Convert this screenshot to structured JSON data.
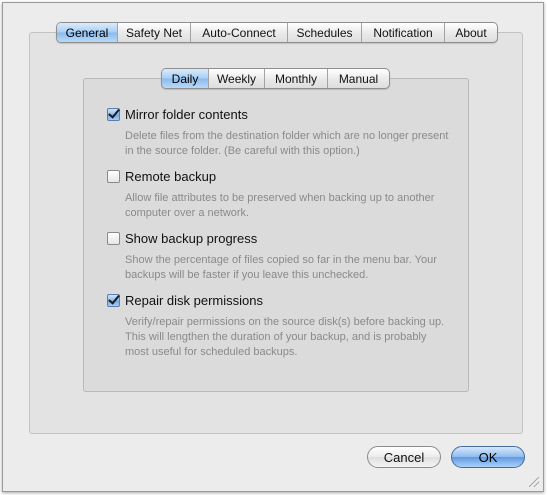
{
  "main_tabs": [
    {
      "label": "General",
      "selected": true
    },
    {
      "label": "Safety Net",
      "selected": false
    },
    {
      "label": "Auto-Connect",
      "selected": false
    },
    {
      "label": "Schedules",
      "selected": false
    },
    {
      "label": "Notification",
      "selected": false
    },
    {
      "label": "About",
      "selected": false
    }
  ],
  "sub_tabs": [
    {
      "label": "Daily",
      "selected": true
    },
    {
      "label": "Weekly",
      "selected": false
    },
    {
      "label": "Monthly",
      "selected": false
    },
    {
      "label": "Manual",
      "selected": false
    }
  ],
  "options": [
    {
      "label": "Mirror folder contents",
      "checked": true,
      "description": "Delete files from the destination folder which are no longer present in the source folder. (Be careful with this option.)"
    },
    {
      "label": "Remote backup",
      "checked": false,
      "description": "Allow file attributes to be preserved when backing up to another computer over a network."
    },
    {
      "label": "Show backup progress",
      "checked": false,
      "description": "Show the percentage of files copied so far in the menu bar. Your backups will be faster if you leave this unchecked."
    },
    {
      "label": "Repair disk permissions",
      "checked": true,
      "description": "Verify/repair permissions on the source disk(s) before backing up. This will lengthen the duration of your backup, and is probably most useful for scheduled backups."
    }
  ],
  "buttons": {
    "cancel_label": "Cancel",
    "ok_label": "OK"
  },
  "colors": {
    "window_bg": "#ececec",
    "selection_blue": "#8ab9ec",
    "description_text": "#8a8a8a"
  }
}
